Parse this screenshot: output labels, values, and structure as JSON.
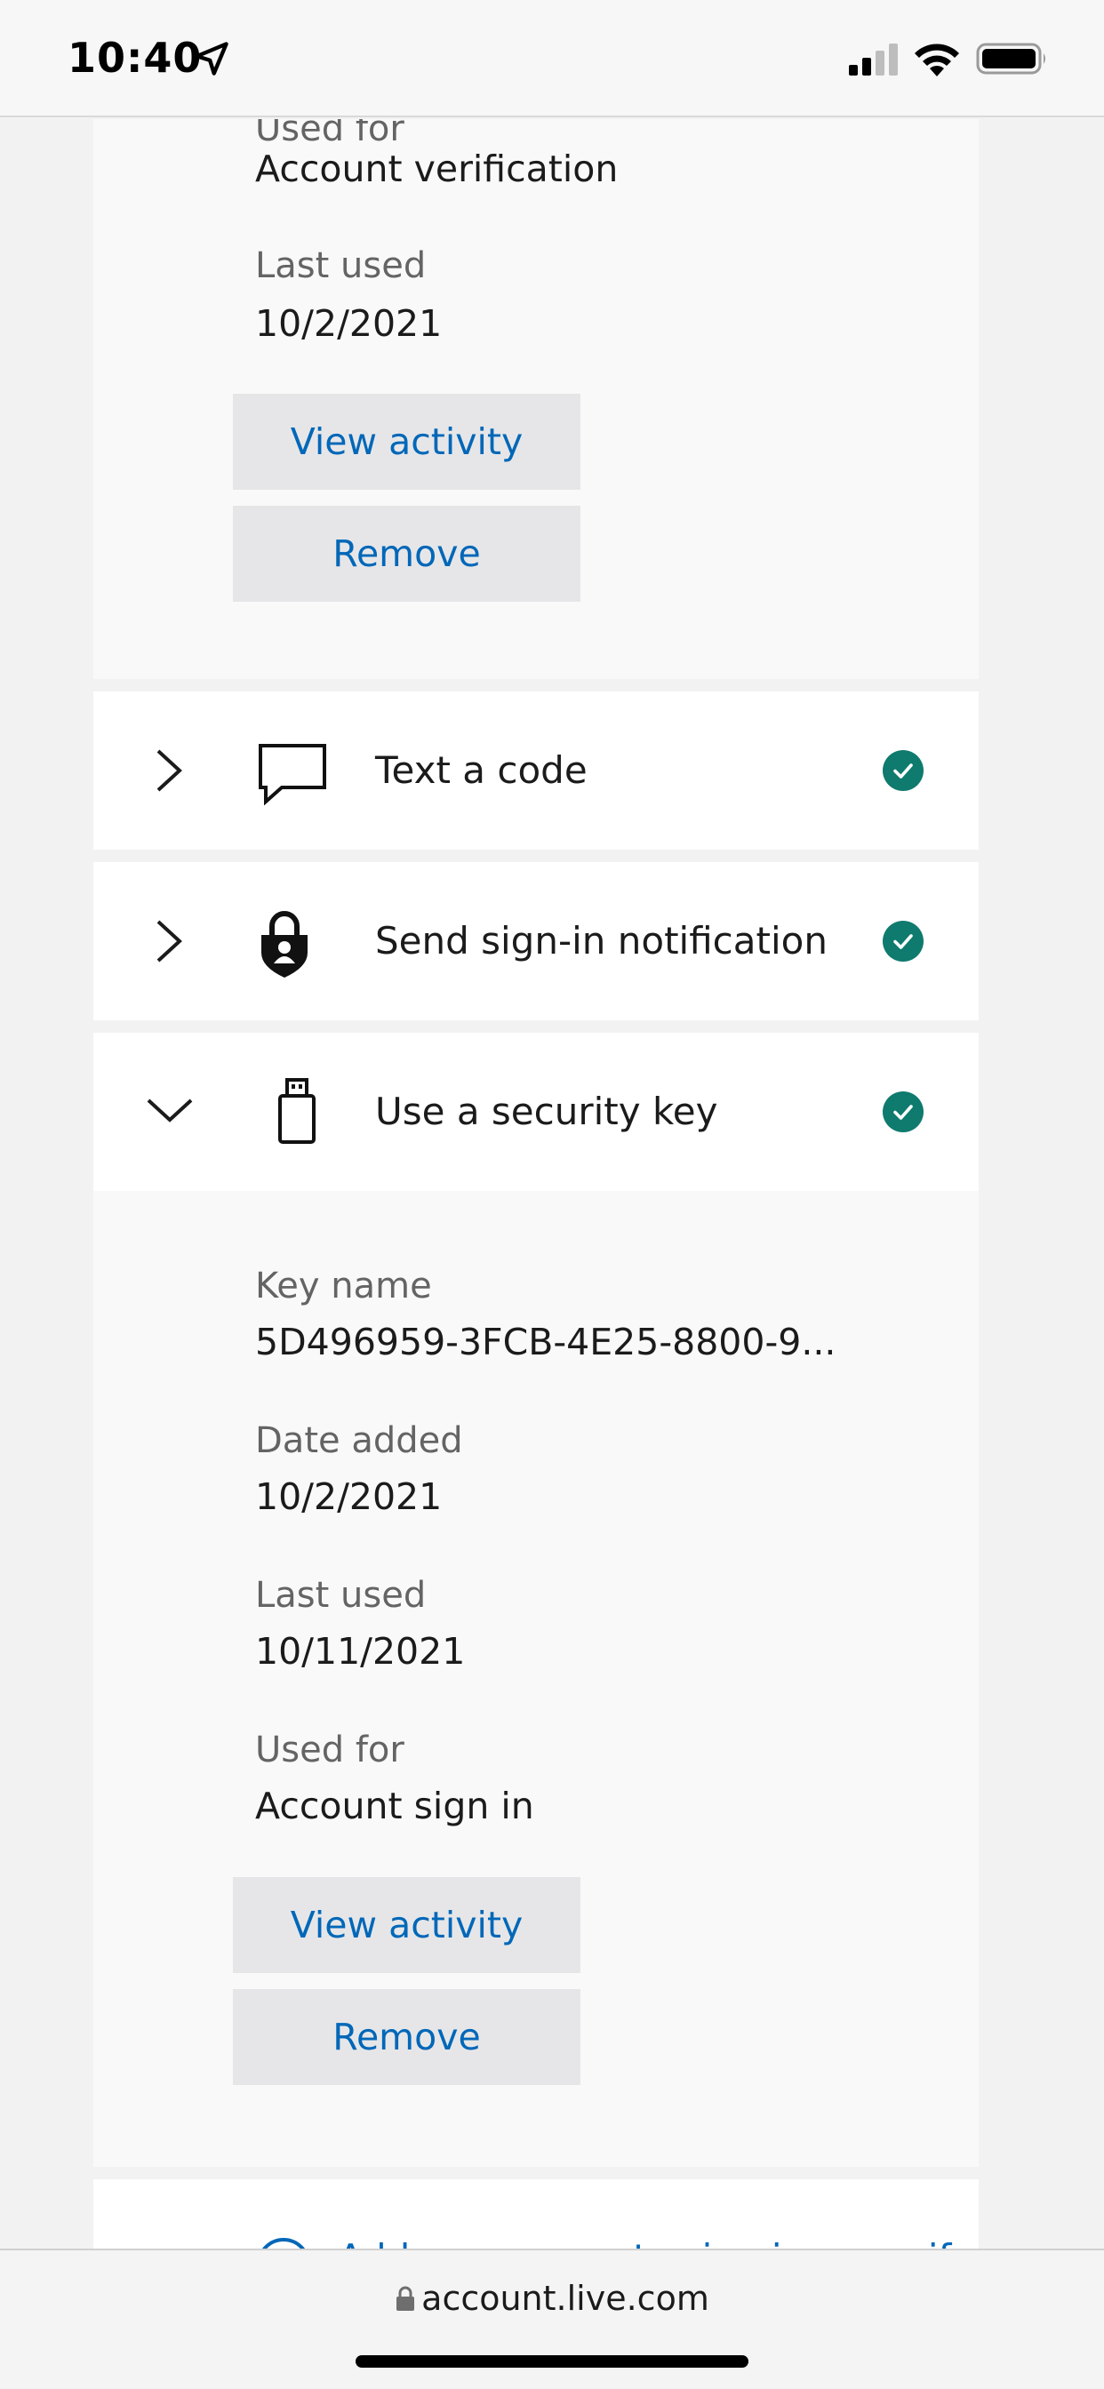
{
  "status_bar": {
    "time": "10:40",
    "icons": [
      "location-arrow-icon",
      "cellular-signal-icon",
      "wifi-icon",
      "battery-icon"
    ]
  },
  "top_card": {
    "used_for_label": "Used for",
    "used_for_value": "Account verification",
    "last_used_label": "Last used",
    "last_used_value": "10/2/2021",
    "view_activity_label": "View activity",
    "remove_label": "Remove"
  },
  "methods": [
    {
      "label": "Text a code",
      "icon": "chat-bubble-icon",
      "expanded": false,
      "verified": true
    },
    {
      "label": "Send sign-in notification",
      "icon": "lock-person-icon",
      "expanded": false,
      "verified": true
    },
    {
      "label": "Use a security key",
      "icon": "usb-key-icon",
      "expanded": true,
      "verified": true
    }
  ],
  "security_key_details": {
    "key_name_label": "Key name",
    "key_name_value": "5D496959-3FCB-4E25-8800-9...",
    "date_added_label": "Date added",
    "date_added_value": "10/2/2021",
    "last_used_label": "Last used",
    "last_used_value": "10/11/2021",
    "used_for_label": "Used for",
    "used_for_value": "Account sign in",
    "view_activity_label": "View activity",
    "remove_label": "Remove"
  },
  "add_method": {
    "label": "Add a new way to sign in or verify"
  },
  "browser": {
    "url": "account.live.com"
  },
  "colors": {
    "link": "#0067b8",
    "check": "#0f7a6e",
    "panel": "#f9f9f9",
    "button": "#e6e6e8"
  }
}
